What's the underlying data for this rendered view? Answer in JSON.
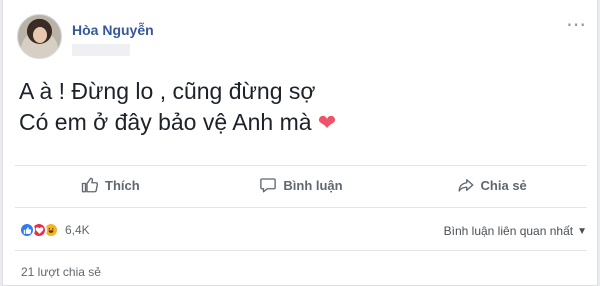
{
  "author": {
    "name": "Hòa Nguyễn"
  },
  "post": {
    "line1": "A à ! Đừng lo , cũng đừng sợ",
    "line2": "Có em ở đây bảo vệ Anh mà",
    "emoji": "❤"
  },
  "actions": {
    "like": "Thích",
    "comment": "Bình luận",
    "share": "Chia sẻ"
  },
  "stats": {
    "reaction_count": "6,4K",
    "reactions": [
      "like-icon",
      "love-icon",
      "haha-icon"
    ],
    "sort_label": "Bình luận liên quan nhất",
    "shares": "21 lượt chia sẻ"
  },
  "colors": {
    "author": "#365899",
    "like": "#2e7bf0",
    "love": "#f0284a",
    "haha": "#f7b125"
  }
}
